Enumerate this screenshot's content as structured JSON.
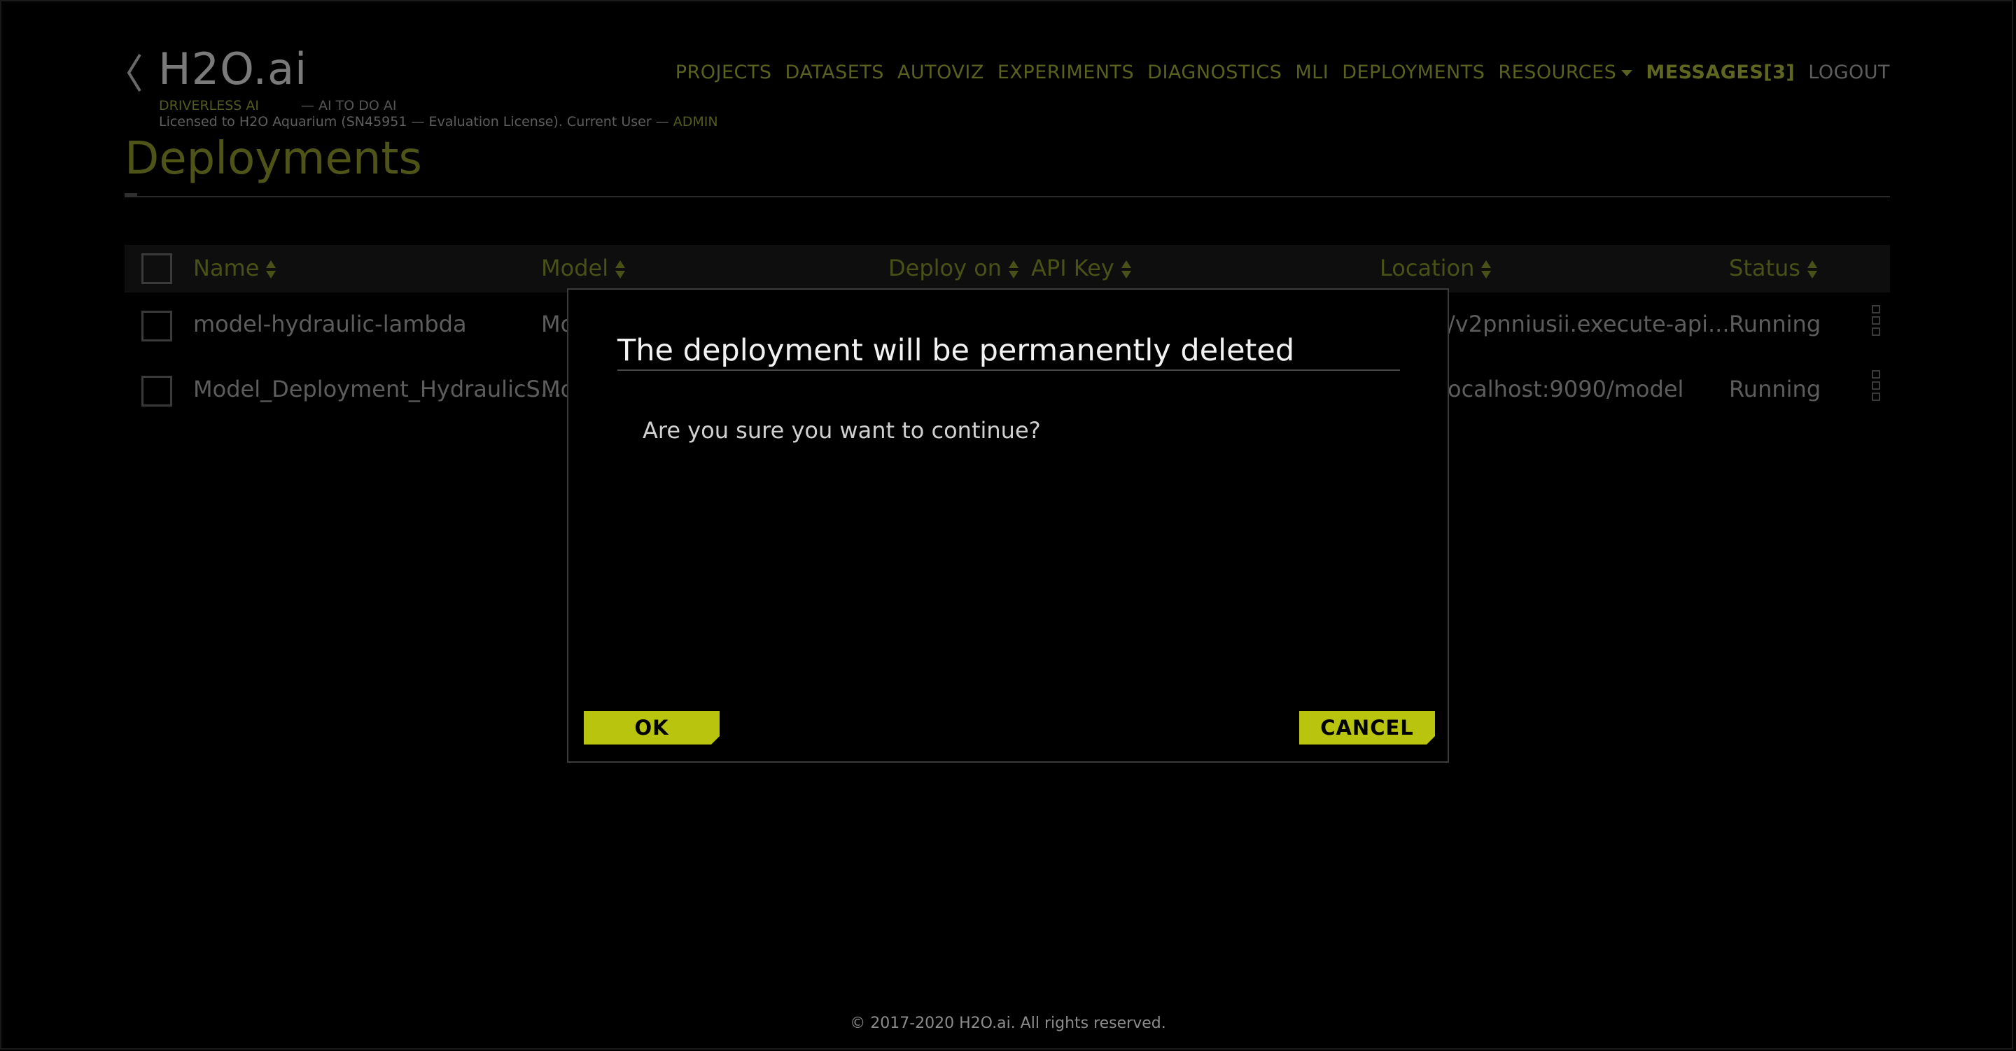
{
  "brand": {
    "logo": "H2O.ai",
    "product": "DRIVERLESS AI",
    "tagline": "— AI TO DO AI",
    "license_prefix": "Licensed to H2O Aquarium (SN45951 — Evaluation License). Current User — ",
    "user": "ADMIN"
  },
  "nav": {
    "projects": "PROJECTS",
    "datasets": "DATASETS",
    "autoviz": "AUTOVIZ",
    "experiments": "EXPERIMENTS",
    "diagnostics": "DIAGNOSTICS",
    "mli": "MLI",
    "deployments": "DEPLOYMENTS",
    "resources": "RESOURCES",
    "messages": "MESSAGES[3]",
    "logout": "LOGOUT"
  },
  "page": {
    "title": "Deployments"
  },
  "table": {
    "columns": {
      "name": "Name",
      "model": "Model",
      "deploy_on": "Deploy on",
      "api_key": "API Key",
      "location": "Location",
      "status": "Status"
    },
    "rows": [
      {
        "name": "model-hydraulic-lambda",
        "model": "Mo",
        "location": "/v2pnniusii.execute-api....",
        "status": "Running"
      },
      {
        "name": "Model_Deployment_HydraulicS...",
        "model": "Mo",
        "location": "ocalhost:9090/model",
        "status": "Running"
      }
    ]
  },
  "modal": {
    "title": "The deployment will be permanently deleted",
    "body": "Are you sure you want to continue?",
    "ok_label": "OK",
    "cancel_label": "CANCEL"
  },
  "footer": {
    "copyright": "© 2017-2020 H2O.ai. All rights reserved."
  },
  "colors": {
    "accent": "#b9c40f",
    "background": "#000000"
  }
}
